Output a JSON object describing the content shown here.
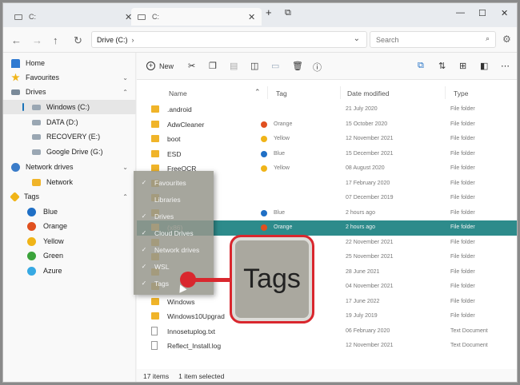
{
  "tabs": [
    {
      "label": "C:",
      "active": false
    },
    {
      "label": "C:",
      "active": true
    }
  ],
  "address": {
    "path": "Drive (C:)",
    "search_placeholder": "Search"
  },
  "toolbar": {
    "new_label": "New"
  },
  "sidebar": {
    "home": "Home",
    "favourites": "Favourites",
    "drives": "Drives",
    "drive_items": [
      "Windows (C:)",
      "DATA (D:)",
      "RECOVERY (E:)",
      "Google Drive (G:)"
    ],
    "network_drives": "Network drives",
    "network": "Network",
    "tags": "Tags",
    "tag_items": [
      {
        "label": "Blue",
        "color": "#1f6fc5"
      },
      {
        "label": "Orange",
        "color": "#e0501f"
      },
      {
        "label": "Yellow",
        "color": "#f0b418"
      },
      {
        "label": "Green",
        "color": "#3ba33b"
      },
      {
        "label": "Azure",
        "color": "#37a9e3"
      }
    ]
  },
  "columns": {
    "name": "Name",
    "tag": "Tag",
    "date": "Date modified",
    "type": "Type"
  },
  "rows": [
    {
      "name": ".android",
      "tag": "",
      "date": "21 July 2020",
      "type": "File folder"
    },
    {
      "name": "AdwCleaner",
      "tag": "Orange",
      "date": "15 October 2020",
      "type": "File folder"
    },
    {
      "name": "boot",
      "tag": "Yellow",
      "date": "12 November 2021",
      "type": "File folder"
    },
    {
      "name": "ESD",
      "tag": "Blue",
      "date": "15 December 2021",
      "type": "File folder"
    },
    {
      "name": "FreeOCR",
      "tag": "Yellow",
      "date": "08 August 2020",
      "type": "File folder"
    },
    {
      "name": "",
      "tag": "",
      "date": "17 February 2020",
      "type": "File folder"
    },
    {
      "name": "",
      "tag": "",
      "date": "07 December 2019",
      "type": "File folder"
    },
    {
      "name": "",
      "tag": "Blue",
      "date": "2 hours ago",
      "type": "File folder"
    },
    {
      "name": "(x86)",
      "tag": "Orange",
      "date": "2 hours ago",
      "type": "File folder"
    },
    {
      "name": "",
      "tag": "",
      "date": "22 November 2021",
      "type": "File folder"
    },
    {
      "name": "",
      "tag": "",
      "date": "25 November 2021",
      "type": "File folder"
    },
    {
      "name": "",
      "tag": "",
      "date": "28 June 2021",
      "type": "File folder"
    },
    {
      "name": "",
      "tag": "",
      "date": "04 November 2021",
      "type": "File folder"
    },
    {
      "name": "Windows",
      "tag": "",
      "date": "17 June 2022",
      "type": "File folder"
    },
    {
      "name": "Windows10Upgrad",
      "tag": "",
      "date": "19 July 2019",
      "type": "File folder"
    },
    {
      "name": "Innosetuplog.txt",
      "tag": "",
      "date": "06 February 2020",
      "type": "Text Document"
    },
    {
      "name": "Reflect_Install.log",
      "tag": "",
      "date": "12 November 2021",
      "type": "Text Document"
    }
  ],
  "status": {
    "items": "17 items",
    "selected": "1 item selected"
  },
  "context_menu": [
    {
      "label": "Favourites",
      "checked": true
    },
    {
      "label": "Libraries",
      "checked": false
    },
    {
      "label": "Drives",
      "checked": true
    },
    {
      "label": "Cloud Drives",
      "checked": true
    },
    {
      "label": "Network drives",
      "checked": true
    },
    {
      "label": "WSL",
      "checked": true
    },
    {
      "label": "Tags",
      "checked": true
    }
  ],
  "callout": {
    "label": "Tags"
  },
  "colors": {
    "highlight_row": "#2d8b8b",
    "accent_red": "#d9272e",
    "folder": "#f0b429"
  }
}
